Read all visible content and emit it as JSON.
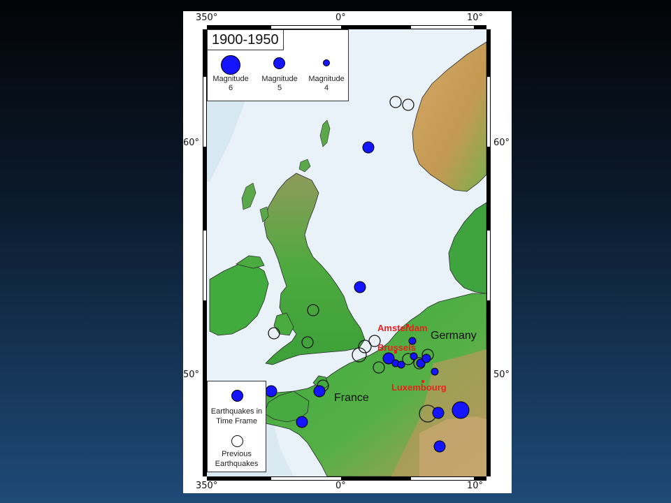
{
  "map": {
    "longitude_labels": [
      "350°",
      "0°",
      "10°"
    ],
    "latitude_labels": [
      "60°",
      "50°"
    ]
  },
  "legend_magnitude": {
    "period": "1900-1950",
    "items": [
      {
        "line1": "Magnitude",
        "line2": "6",
        "magnitude": 6
      },
      {
        "line1": "Magnitude",
        "line2": "5",
        "magnitude": 5
      },
      {
        "line1": "Magnitude",
        "line2": "4",
        "magnitude": 4
      }
    ]
  },
  "legend_type": {
    "in_frame_line1": "Earthquakes in",
    "in_frame_line2": "Time Frame",
    "previous_line1": "Previous",
    "previous_line2": "Earthquakes"
  },
  "place_labels": {
    "amsterdam": "Amsterdam",
    "brussels": "Brussels",
    "luxembourg": "Luxembourg",
    "germany": "Germany",
    "france": "France"
  },
  "colors": {
    "quake_fill": "#1414ff",
    "city_label": "#e8211e",
    "sea": "#e8f2f8",
    "lowland": "#3aa83e",
    "highland": "#c49a52"
  }
}
